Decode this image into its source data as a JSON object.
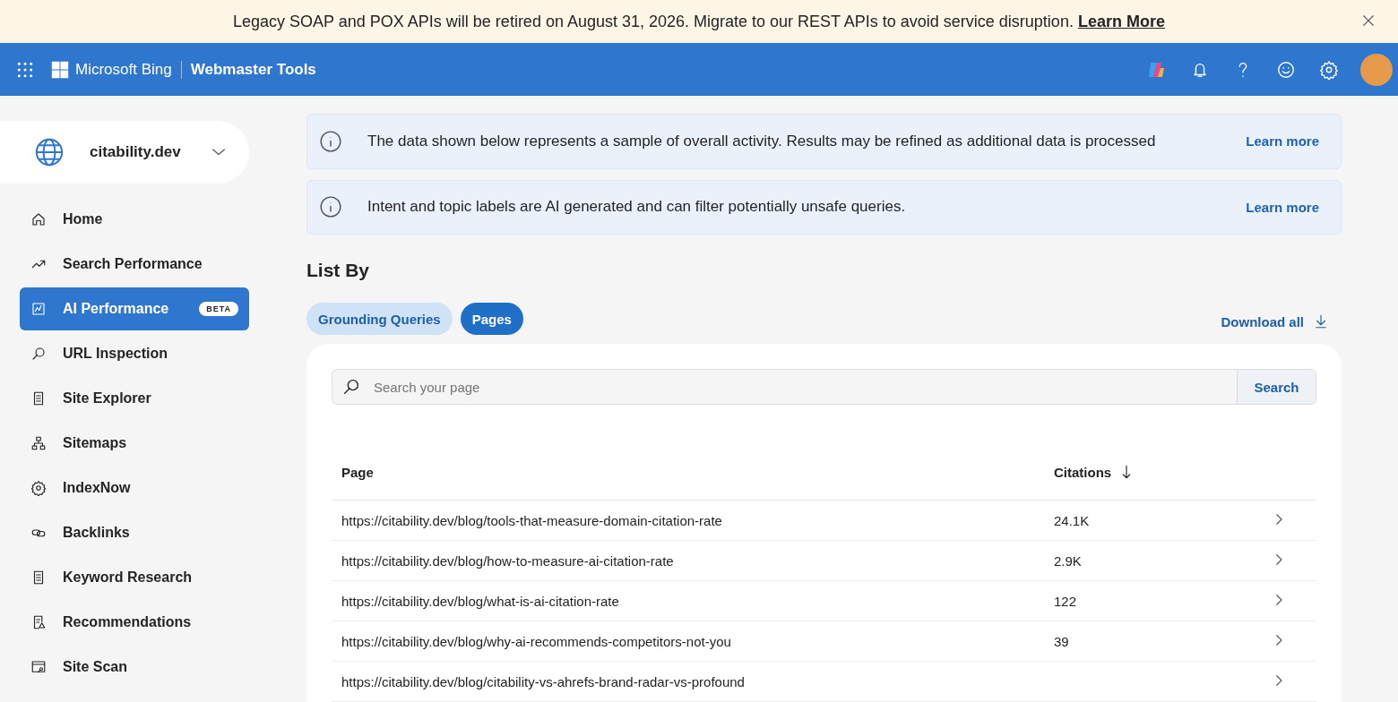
{
  "banner": {
    "text": "Legacy SOAP and POX APIs will be retired on August 31, 2026. Migrate to our REST APIs to avoid service disruption.",
    "link": "Learn More"
  },
  "header": {
    "brand": "Microsoft Bing",
    "product": "Webmaster Tools"
  },
  "site_picker": {
    "site": "citability.dev"
  },
  "sidebar": {
    "items": [
      {
        "label": "Home",
        "selected": false
      },
      {
        "label": "Search Performance",
        "selected": false
      },
      {
        "label": "AI Performance",
        "selected": true,
        "badge": "BETA"
      },
      {
        "label": "URL Inspection",
        "selected": false
      },
      {
        "label": "Site Explorer",
        "selected": false
      },
      {
        "label": "Sitemaps",
        "selected": false
      },
      {
        "label": "IndexNow",
        "selected": false
      },
      {
        "label": "Backlinks",
        "selected": false
      },
      {
        "label": "Keyword Research",
        "selected": false
      },
      {
        "label": "Recommendations",
        "selected": false
      },
      {
        "label": "Site Scan",
        "selected": false
      }
    ]
  },
  "notices": [
    {
      "text": "The data shown below represents a sample of overall activity. Results may be refined as additional data is processed",
      "link": "Learn more"
    },
    {
      "text": "Intent and topic labels are AI generated and can filter potentially unsafe queries.",
      "link": "Learn more"
    }
  ],
  "list_by": {
    "title": "List By",
    "tabs": [
      {
        "label": "Grounding Queries",
        "selected": false
      },
      {
        "label": "Pages",
        "selected": true
      }
    ],
    "download": "Download all"
  },
  "search": {
    "placeholder": "Search your page",
    "button": "Search"
  },
  "table": {
    "columns": [
      {
        "label": "Page",
        "sorted": false
      },
      {
        "label": "Citations",
        "sorted": true
      }
    ],
    "rows": [
      {
        "page": "https://citability.dev/blog/tools-that-measure-domain-citation-rate",
        "citations": "24.1K"
      },
      {
        "page": "https://citability.dev/blog/how-to-measure-ai-citation-rate",
        "citations": "2.9K"
      },
      {
        "page": "https://citability.dev/blog/what-is-ai-citation-rate",
        "citations": "122"
      },
      {
        "page": "https://citability.dev/blog/why-ai-recommends-competitors-not-you",
        "citations": "39"
      },
      {
        "page": "https://citability.dev/blog/citability-vs-ahrefs-brand-radar-vs-profound"
      }
    ]
  }
}
